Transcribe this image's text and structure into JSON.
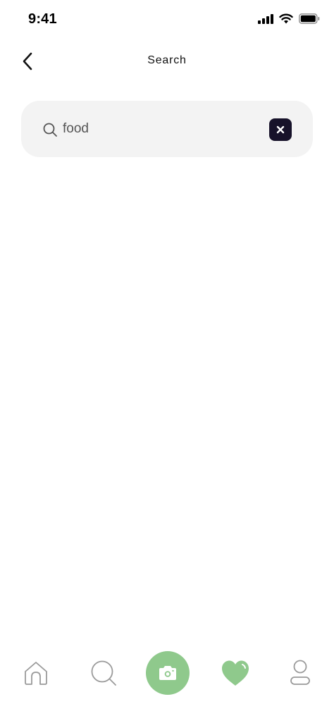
{
  "status_bar": {
    "time": "9:41",
    "icons": [
      "signal-icon",
      "wifi-icon",
      "battery-icon"
    ]
  },
  "header": {
    "back_icon": "chevron-left-icon",
    "title": "Search"
  },
  "search": {
    "value": "food",
    "icon": "search-icon",
    "clear_icon": "close-icon"
  },
  "tab_bar": {
    "items": [
      {
        "icon": "home-icon"
      },
      {
        "icon": "search-icon"
      },
      {
        "icon": "camera-icon"
      },
      {
        "icon": "heart-icon"
      },
      {
        "icon": "profile-icon"
      }
    ]
  },
  "colors": {
    "accent_green": "#8fc98c",
    "clear_button": "#17122a",
    "search_background": "#f3f3f3",
    "inactive_icon": "#9a9a9a"
  }
}
